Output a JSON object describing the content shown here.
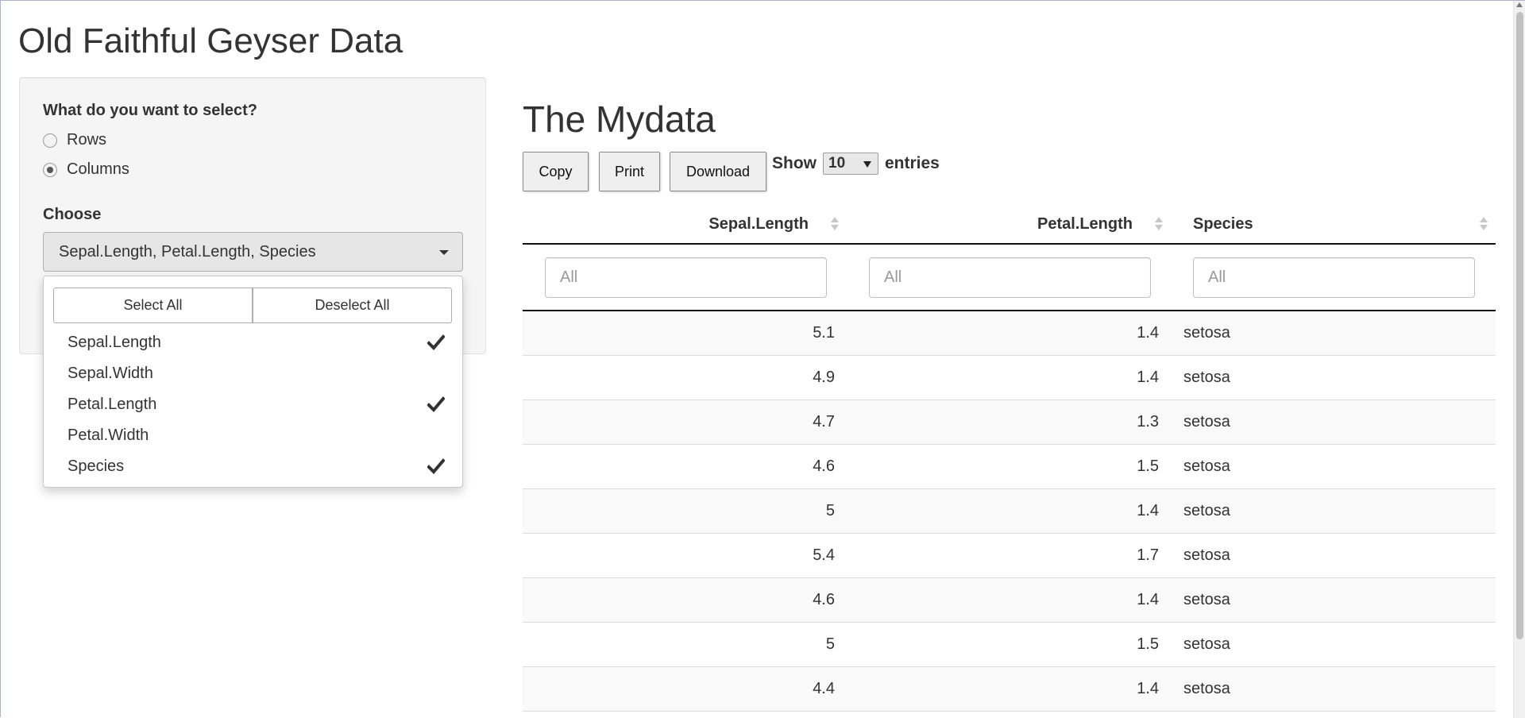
{
  "app": {
    "title": "Old Faithful Geyser Data"
  },
  "sidebar": {
    "select_label": "What do you want to select?",
    "radio_options": [
      "Rows",
      "Columns"
    ],
    "selected_radio": "Columns",
    "choose_label": "Choose",
    "picker_value": "Sepal.Length, Petal.Length, Species",
    "dropdown": {
      "select_all": "Select All",
      "deselect_all": "Deselect All",
      "options": [
        {
          "label": "Sepal.Length",
          "checked": true
        },
        {
          "label": "Sepal.Width",
          "checked": false
        },
        {
          "label": "Petal.Length",
          "checked": true
        },
        {
          "label": "Petal.Width",
          "checked": false
        },
        {
          "label": "Species",
          "checked": true
        }
      ]
    }
  },
  "main": {
    "title": "The Mydata",
    "buttons": {
      "copy": "Copy",
      "print": "Print",
      "download": "Download"
    },
    "length": {
      "show": "Show",
      "value": "10",
      "entries": "entries"
    },
    "table": {
      "columns": [
        "Sepal.Length",
        "Petal.Length",
        "Species"
      ],
      "filter_placeholder": "All",
      "rows": [
        [
          "5.1",
          "1.4",
          "setosa"
        ],
        [
          "4.9",
          "1.4",
          "setosa"
        ],
        [
          "4.7",
          "1.3",
          "setosa"
        ],
        [
          "4.6",
          "1.5",
          "setosa"
        ],
        [
          "5",
          "1.4",
          "setosa"
        ],
        [
          "5.4",
          "1.7",
          "setosa"
        ],
        [
          "4.6",
          "1.4",
          "setosa"
        ],
        [
          "5",
          "1.5",
          "setosa"
        ],
        [
          "4.4",
          "1.4",
          "setosa"
        ]
      ]
    }
  }
}
